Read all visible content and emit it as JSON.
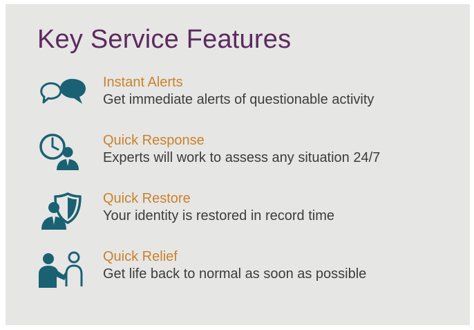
{
  "title": "Key Service Features",
  "accent_color": "#c9822a",
  "title_color": "#5c2a5e",
  "icon_color": "#1a6173",
  "features": [
    {
      "icon": "chat-bubbles-icon",
      "title": "Instant Alerts",
      "description": "Get immediate alerts of questionable activity"
    },
    {
      "icon": "clock-person-icon",
      "title": "Quick Response",
      "description": "Experts will work to assess any situation 24/7"
    },
    {
      "icon": "shield-person-icon",
      "title": "Quick Restore",
      "description": "Your identity is restored in record time"
    },
    {
      "icon": "helping-hand-icon",
      "title": "Quick Relief",
      "description": "Get life back to normal as soon as possible"
    }
  ]
}
